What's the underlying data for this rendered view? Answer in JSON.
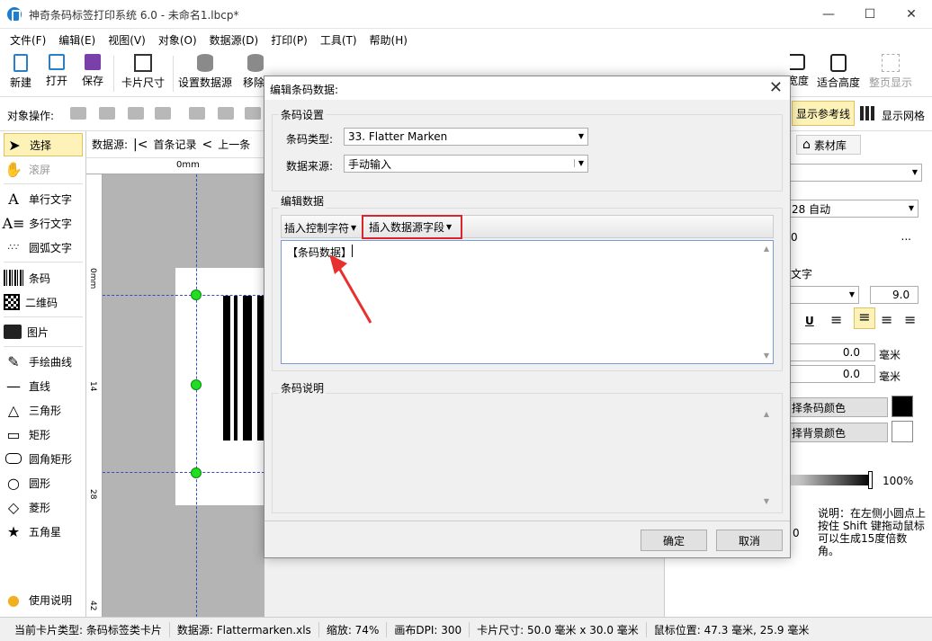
{
  "window": {
    "title": "神奇条码标签打印系统 6.0 - 未命名1.lbcp*",
    "minimize": "—",
    "maximize": "☐",
    "close": "✕"
  },
  "menu": [
    "文件(F)",
    "编辑(E)",
    "视图(V)",
    "对象(O)",
    "数据源(D)",
    "打印(P)",
    "工具(T)",
    "帮助(H)"
  ],
  "toolbar": {
    "new": "新建",
    "open": "打开",
    "save": "保存",
    "card_size": "卡片尺寸",
    "set_datasource": "设置数据源",
    "remove": "移除",
    "height_partial": "宽度",
    "fit_height": "适合高度",
    "whole_page": "整页显示"
  },
  "opsbar": {
    "label": "对象操作:",
    "show_guides": "显示参考线",
    "show_grid": "显示网格"
  },
  "toolbox": {
    "items": [
      "选择",
      "滚屏",
      "单行文字",
      "多行文字",
      "圆弧文字",
      "条码",
      "二维码",
      "图片",
      "手绘曲线",
      "直线",
      "三角形",
      "矩形",
      "圆角矩形",
      "圆形",
      "菱形",
      "五角星"
    ],
    "help": "使用说明"
  },
  "dsbar": {
    "label": "数据源:",
    "first": "首条记录",
    "prev": "上一条"
  },
  "ruler": {
    "h_zero": "0mm",
    "v_marks": [
      "0mm",
      "14",
      "28",
      "42"
    ]
  },
  "rightpanel": {
    "tab_material": "素材库",
    "code128": "28 自动",
    "zero": "0",
    "more": "...",
    "text_label": "文字",
    "font_size": "9.0",
    "offset1": "0.0",
    "offset2": "0.0",
    "unit": "毫米",
    "barcode_color": "择条码颜色",
    "bg_color": "择背景颜色",
    "opacity": "100%",
    "zero2": "0",
    "hint": "说明：在左侧小圆点上按住 Shift 键拖动鼠标可以生成15度倍数角。",
    "colors": {
      "barcode": "#000000",
      "background": "#ffffff"
    }
  },
  "status": {
    "card_type": "当前卡片类型: 条码标签类卡片",
    "datasource": "数据源: Flattermarken.xls",
    "zoom": "缩放: 74%",
    "dpi": "画布DPI: 300",
    "card_size": "卡片尺寸: 50.0 毫米 x 30.0 毫米",
    "mouse": "鼠标位置: 47.3 毫米, 25.9 毫米"
  },
  "dialog": {
    "title": "编辑条码数据:",
    "barcode_settings": "条码设置",
    "type_label": "条码类型:",
    "type_value": "33.  Flatter Marken",
    "source_label": "数据来源:",
    "source_value": "手动输入",
    "edit_data": "编辑数据",
    "insert_control": "插入控制字符",
    "insert_field": "插入数据源字段",
    "content": "【条码数据】",
    "description": "条码说明",
    "ok": "确定",
    "cancel": "取消"
  },
  "colors": {
    "accent": "#1a7fd4",
    "highlight_border": "#d9262c",
    "arrow": "#e83030"
  }
}
